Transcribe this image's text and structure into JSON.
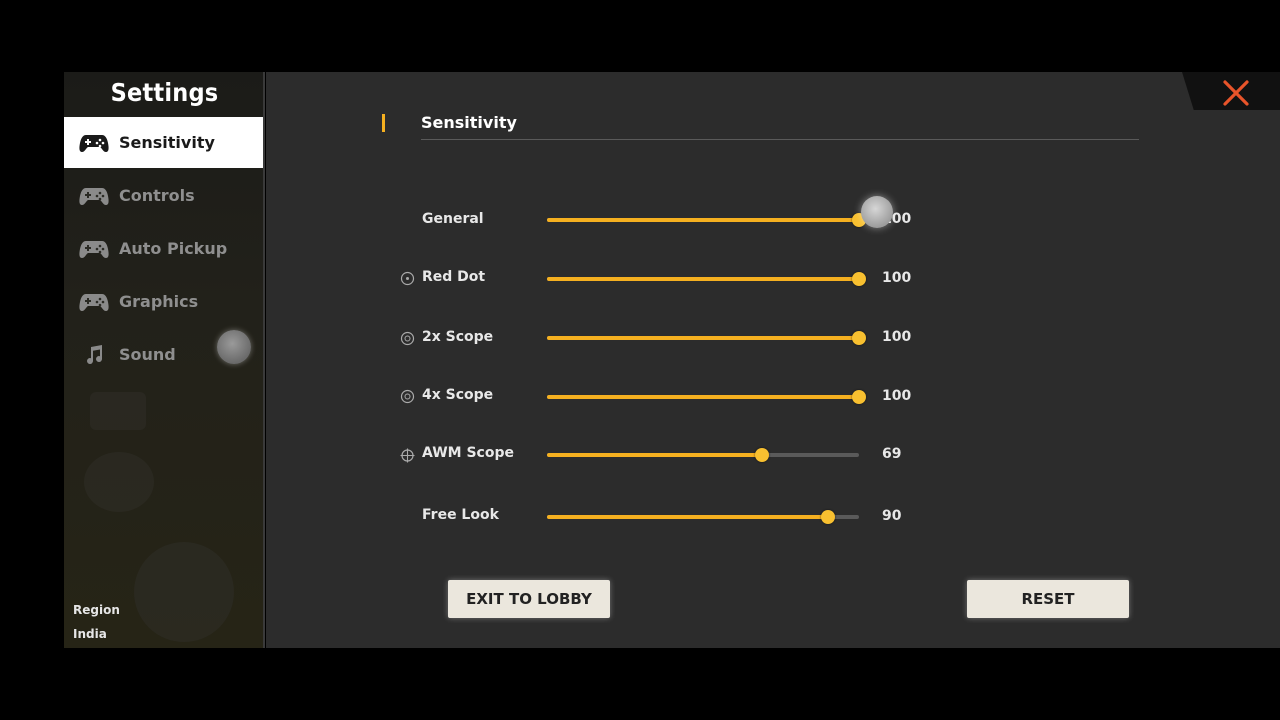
{
  "sidebar": {
    "title": "Settings",
    "items": [
      {
        "label": "Sensitivity",
        "icon": "gamepad-icon",
        "active": true
      },
      {
        "label": "Controls",
        "icon": "gamepad-icon",
        "active": false
      },
      {
        "label": "Auto Pickup",
        "icon": "gamepad-icon",
        "active": false
      },
      {
        "label": "Graphics",
        "icon": "gamepad-icon",
        "active": false
      },
      {
        "label": "Sound",
        "icon": "music-note-icon",
        "active": false
      }
    ],
    "region_label": "Region",
    "region_value": "India"
  },
  "section": {
    "title": "Sensitivity"
  },
  "sliders": [
    {
      "label": "General",
      "value": "100",
      "fraction": 1.0,
      "icon": null
    },
    {
      "label": "Red Dot",
      "value": "100",
      "fraction": 1.0,
      "icon": "red-dot-icon"
    },
    {
      "label": "2x Scope",
      "value": "100",
      "fraction": 1.0,
      "icon": "scope-icon"
    },
    {
      "label": "4x Scope",
      "value": "100",
      "fraction": 1.0,
      "icon": "scope-icon"
    },
    {
      "label": "AWM Scope",
      "value": "69",
      "fraction": 0.69,
      "icon": "crosshair-icon"
    },
    {
      "label": "Free Look",
      "value": "90",
      "fraction": 0.9,
      "icon": null
    }
  ],
  "buttons": {
    "exit": "EXIT TO LOBBY",
    "reset": "RESET"
  },
  "colors": {
    "accent": "#f5b020",
    "close": "#e8542a"
  }
}
